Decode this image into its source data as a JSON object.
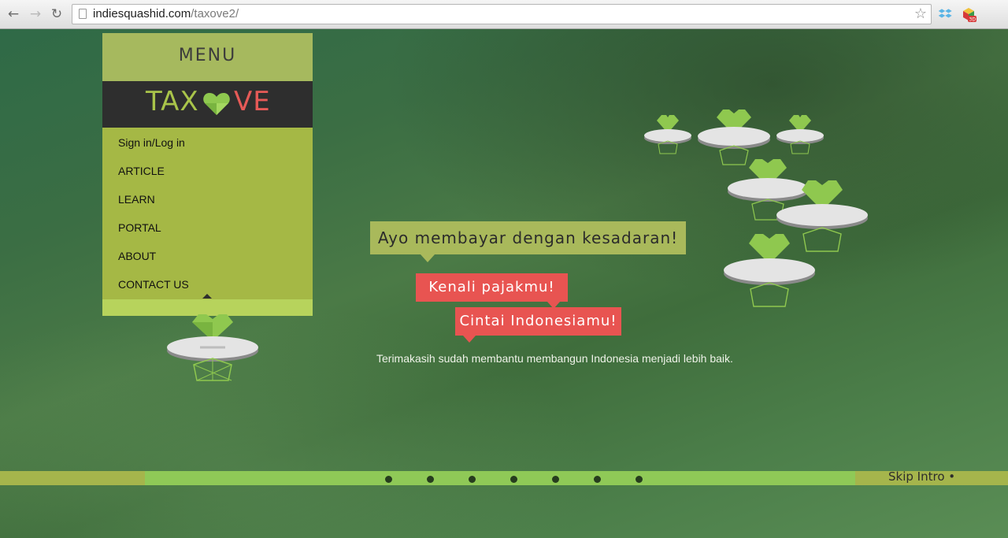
{
  "browser": {
    "url_host": "indiesquashid.com",
    "url_path": "/taxove2/",
    "back_icon": "←",
    "forward_icon": "→",
    "reload_icon": "↻",
    "star_icon": "☆"
  },
  "menu": {
    "title": "MENU",
    "logo_left": "TAX",
    "logo_right": "VE",
    "items": [
      "Sign in/Log in",
      "ARTICLE",
      "LEARN",
      "PORTAL",
      "ABOUT",
      "CONTACT US"
    ]
  },
  "bubbles": {
    "main": "Ayo membayar dengan kesadaran!",
    "second": "Kenali pajakmu!",
    "third": "Cintai Indonesiamu!"
  },
  "thanks_text": "Terimakasih sudah membantu membangun Indonesia menjadi lebih baik.",
  "skip_label": "Skip Intro •",
  "progress_dot_count": 7,
  "colors": {
    "green_accent": "#a9c44a",
    "red_accent": "#e65a57",
    "menu_bg": "#a5b845",
    "progress_green": "#8fc957"
  }
}
